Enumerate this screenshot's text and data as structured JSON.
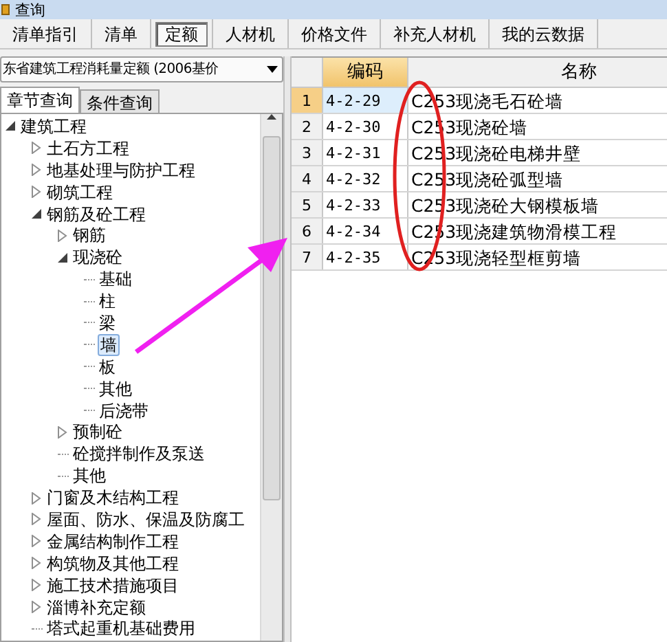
{
  "window": {
    "title": "查询"
  },
  "tabs": [
    {
      "label": "清单指引",
      "selected": false
    },
    {
      "label": "清单",
      "selected": false
    },
    {
      "label": "定额",
      "selected": true
    },
    {
      "label": "人材机",
      "selected": false
    },
    {
      "label": "价格文件",
      "selected": false
    },
    {
      "label": "补充人材机",
      "selected": false
    },
    {
      "label": "我的云数据",
      "selected": false
    }
  ],
  "library_select": {
    "value": "东省建筑工程消耗量定额 (2006基价"
  },
  "query_tabs": [
    {
      "label": "章节查询",
      "selected": true
    },
    {
      "label": "条件查询",
      "selected": false
    }
  ],
  "tree": [
    {
      "label": "建筑工程",
      "expanded": true,
      "selected": false,
      "children": [
        {
          "label": "土石方工程",
          "expanded": false,
          "selected": false
        },
        {
          "label": "地基处理与防护工程",
          "expanded": false,
          "selected": false
        },
        {
          "label": "砌筑工程",
          "expanded": false,
          "selected": false
        },
        {
          "label": "钢筋及砼工程",
          "expanded": true,
          "selected": false,
          "children": [
            {
              "label": "钢筋",
              "expanded": false,
              "selected": false
            },
            {
              "label": "现浇砼",
              "expanded": true,
              "selected": false,
              "children": [
                {
                  "label": "基础",
                  "selected": false
                },
                {
                  "label": "柱",
                  "selected": false
                },
                {
                  "label": "梁",
                  "selected": false
                },
                {
                  "label": "墙",
                  "selected": true
                },
                {
                  "label": "板",
                  "selected": false
                },
                {
                  "label": "其他",
                  "selected": false
                },
                {
                  "label": "后浇带",
                  "selected": false
                }
              ]
            },
            {
              "label": "预制砼",
              "expanded": false,
              "selected": false
            },
            {
              "label": "砼搅拌制作及泵送",
              "selected": false
            },
            {
              "label": "其他",
              "selected": false
            }
          ]
        },
        {
          "label": "门窗及木结构工程",
          "expanded": false,
          "selected": false
        },
        {
          "label": "屋面、防水、保温及防腐工",
          "expanded": false,
          "selected": false
        },
        {
          "label": "金属结构制作工程",
          "expanded": false,
          "selected": false
        },
        {
          "label": "构筑物及其他工程",
          "expanded": false,
          "selected": false
        },
        {
          "label": "施工技术措施项目",
          "expanded": false,
          "selected": false
        },
        {
          "label": "淄博补充定额",
          "expanded": false,
          "selected": false
        },
        {
          "label": "塔式起重机基础费用",
          "selected": false
        }
      ]
    }
  ],
  "grid": {
    "columns": [
      "编码",
      "名称"
    ],
    "rows": [
      {
        "index": "1",
        "code": "4-2-29",
        "name": "C253现浇毛石砼墙",
        "selected": true
      },
      {
        "index": "2",
        "code": "4-2-30",
        "name": "C253现浇砼墙",
        "selected": false
      },
      {
        "index": "3",
        "code": "4-2-31",
        "name": "C253现浇砼电梯井壁",
        "selected": false
      },
      {
        "index": "4",
        "code": "4-2-32",
        "name": "C253现浇砼弧型墙",
        "selected": false
      },
      {
        "index": "5",
        "code": "4-2-33",
        "name": "C253现浇砼大钢模板墙",
        "selected": false
      },
      {
        "index": "6",
        "code": "4-2-34",
        "name": "C253现浇建筑物滑模工程",
        "selected": false
      },
      {
        "index": "7",
        "code": "4-2-35",
        "name": "C253现浇轻型框剪墙",
        "selected": false
      }
    ]
  }
}
